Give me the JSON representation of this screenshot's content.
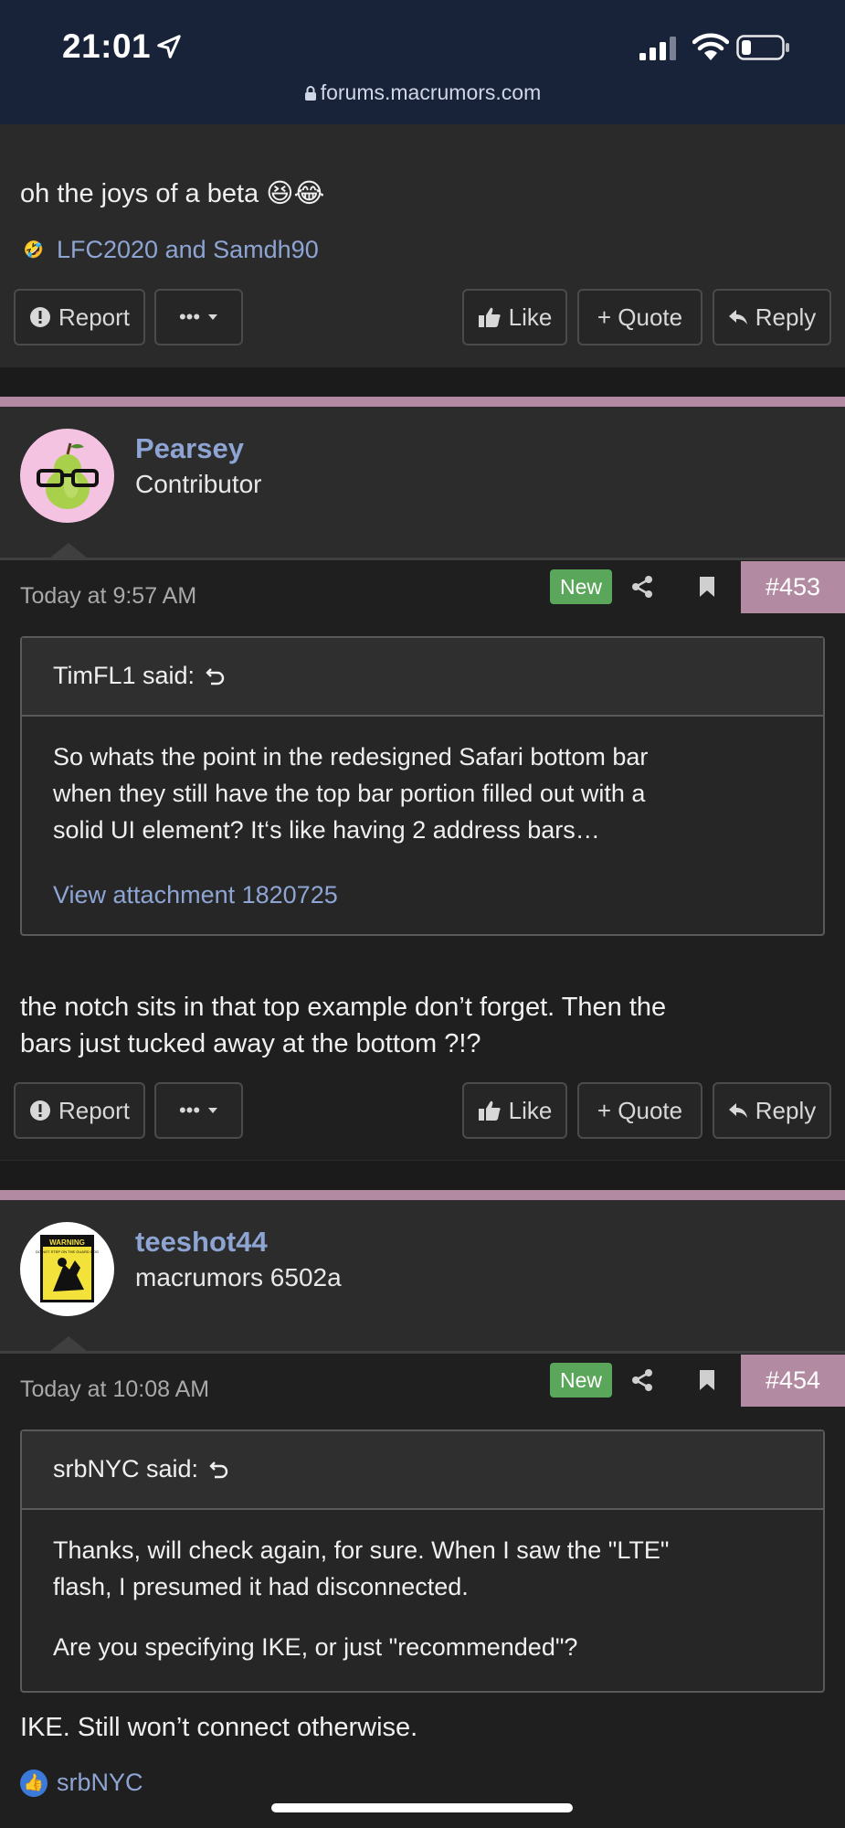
{
  "status_bar": {
    "time": "21:01",
    "url": "forums.macrumors.com"
  },
  "post_prev": {
    "text": "oh the joys of a beta 😆😂",
    "reactions": "LFC2020 and Samdh90",
    "reaction_icon": "🤣",
    "actions": {
      "report": "Report",
      "more": "•••",
      "like": "Like",
      "quote": "+ Quote",
      "reply": "Reply"
    }
  },
  "post_453": {
    "username": "Pearsey",
    "user_title": "Contributor",
    "date": "Today at 9:57 AM",
    "badge": "New",
    "number": "#453",
    "quote": {
      "author": "TimFL1 said:",
      "lines": [
        "So whats the point in the redesigned Safari bottom bar",
        "when they still have the top bar portion filled out with a",
        "solid UI element? It‘s like having 2 address bars…"
      ],
      "attachment": "View attachment 1820725"
    },
    "body_lines": [
      "the notch sits in that top example don’t forget. Then the",
      "bars just tucked away at the bottom ?!?"
    ],
    "actions": {
      "report": "Report",
      "more": "•••",
      "like": "Like",
      "quote": "+ Quote",
      "reply": "Reply"
    }
  },
  "post_454": {
    "username": "teeshot44",
    "user_title": "macrumors 6502a",
    "avatar_text_1": "WARNING",
    "avatar_text_2": "DO NOT STEP ON THE GUARD DOG",
    "date": "Today at 10:08 AM",
    "badge": "New",
    "number": "#454",
    "quote": {
      "author": "srbNYC said:",
      "lines": [
        "Thanks, will check again, for sure. When I saw the \"LTE\"",
        "flash, I presumed it had disconnected."
      ],
      "line_2": "Are you specifying IKE, or just \"recommended\"?"
    },
    "body": "IKE. Still won’t connect otherwise.",
    "reactions": "srbNYC",
    "reaction_icon": "👍"
  },
  "colors": {
    "accent_link": "#8ea5d4",
    "post_number_bg": "#b28aa2",
    "new_badge": "#5aa65a",
    "status_bar_bg": "#18233a"
  }
}
